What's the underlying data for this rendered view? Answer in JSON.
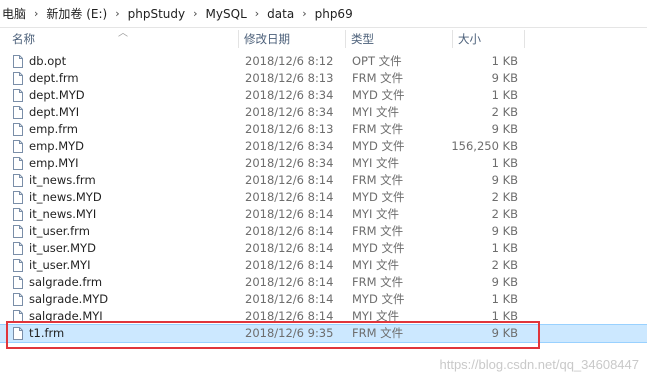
{
  "breadcrumb": [
    "电脑",
    "新加卷 (E:)",
    "phpStudy",
    "MySQL",
    "data",
    "php69"
  ],
  "columns": {
    "name": "名称",
    "date": "修改日期",
    "type": "类型",
    "size": "大小"
  },
  "files": [
    {
      "name": "db.opt",
      "date": "2018/12/6 8:12",
      "type": "OPT 文件",
      "size": "1 KB"
    },
    {
      "name": "dept.frm",
      "date": "2018/12/6 8:13",
      "type": "FRM 文件",
      "size": "9 KB"
    },
    {
      "name": "dept.MYD",
      "date": "2018/12/6 8:34",
      "type": "MYD 文件",
      "size": "1 KB"
    },
    {
      "name": "dept.MYI",
      "date": "2018/12/6 8:34",
      "type": "MYI 文件",
      "size": "2 KB"
    },
    {
      "name": "emp.frm",
      "date": "2018/12/6 8:13",
      "type": "FRM 文件",
      "size": "9 KB"
    },
    {
      "name": "emp.MYD",
      "date": "2018/12/6 8:34",
      "type": "MYD 文件",
      "size": "156,250 KB"
    },
    {
      "name": "emp.MYI",
      "date": "2018/12/6 8:34",
      "type": "MYI 文件",
      "size": "1 KB"
    },
    {
      "name": "it_news.frm",
      "date": "2018/12/6 8:14",
      "type": "FRM 文件",
      "size": "9 KB"
    },
    {
      "name": "it_news.MYD",
      "date": "2018/12/6 8:14",
      "type": "MYD 文件",
      "size": "2 KB"
    },
    {
      "name": "it_news.MYI",
      "date": "2018/12/6 8:14",
      "type": "MYI 文件",
      "size": "2 KB"
    },
    {
      "name": "it_user.frm",
      "date": "2018/12/6 8:14",
      "type": "FRM 文件",
      "size": "9 KB"
    },
    {
      "name": "it_user.MYD",
      "date": "2018/12/6 8:14",
      "type": "MYD 文件",
      "size": "1 KB"
    },
    {
      "name": "it_user.MYI",
      "date": "2018/12/6 8:14",
      "type": "MYI 文件",
      "size": "2 KB"
    },
    {
      "name": "salgrade.frm",
      "date": "2018/12/6 8:14",
      "type": "FRM 文件",
      "size": "9 KB"
    },
    {
      "name": "salgrade.MYD",
      "date": "2018/12/6 8:14",
      "type": "MYD 文件",
      "size": "1 KB"
    },
    {
      "name": "salgrade.MYI",
      "date": "2018/12/6 8:14",
      "type": "MYI 文件",
      "size": "1 KB"
    },
    {
      "name": "t1.frm",
      "date": "2018/12/6 9:35",
      "type": "FRM 文件",
      "size": "9 KB",
      "selected": true
    }
  ],
  "watermark": "https://blog.csdn.net/qq_34608447",
  "colors": {
    "selection": "#cce8ff",
    "highlight_border": "#e0353b",
    "header_text": "#4c607a"
  }
}
